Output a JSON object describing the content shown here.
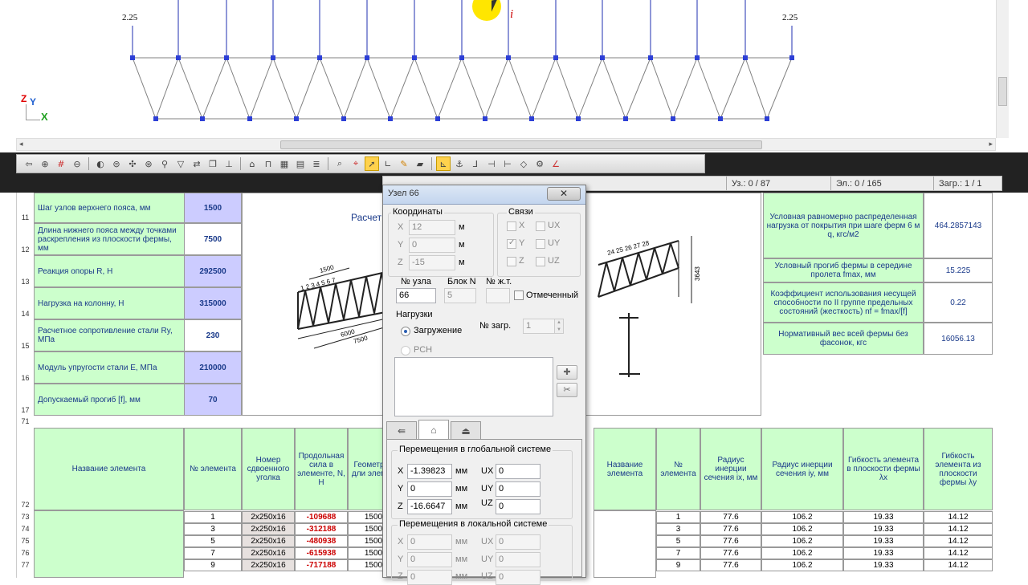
{
  "viewport": {
    "load_left": "2.25",
    "load_right": "2.25",
    "axis_z": "Z",
    "axis_y": "Y",
    "axis_x": "X",
    "cursor_label": "i"
  },
  "statusbar": {
    "nodes": "Уз.: 0 / 87",
    "elements": "Эл.: 0 / 165",
    "loads": "Загр.: 1 / 1"
  },
  "sheet": {
    "rows": [
      {
        "row": "11",
        "label": "Шаг узлов верхнего пояса, мм",
        "value": "1500"
      },
      {
        "row": "12",
        "label": "Длина нижнего пояса между точками раскрепления из плоскости фермы, мм",
        "value": "7500"
      },
      {
        "row": "13",
        "label": "Реакция опоры R, Н",
        "value": "292500"
      },
      {
        "row": "14",
        "label": "Нагрузка на колонну, Н",
        "value": "315000"
      },
      {
        "row": "15",
        "label": "Расчетное сопротивление стали Ry, МПа",
        "value": "230"
      },
      {
        "row": "16",
        "label": "Модуль упругости стали Е, МПа",
        "value": "210000"
      },
      {
        "row": "17",
        "label": "Допускаемый прогиб [f], мм",
        "value": "70"
      }
    ],
    "drawing_title": "Расчет",
    "right_rows": [
      {
        "label": "Условная равномерно распределенная нагрузка от покрытия при шаге ферм 6 м q, кгс/м2",
        "value": "464.2857143"
      },
      {
        "label": "Условный прогиб фермы в середине пролета fmax, мм",
        "value": "15.225"
      },
      {
        "label": "Коэффициент использования несущей способности по II группе предельных состояний (жесткость) nf = fmax/[f]",
        "value": "0.22"
      },
      {
        "label": "Нормативный вес всей фермы без фасонок, кгс",
        "value": "16056.13"
      }
    ],
    "row_71": "71",
    "row_72": "72",
    "table_headers": [
      "Название элемента",
      "№ элемента",
      "Номер сдвоенного уголка",
      "Продольная сила в элементе, N, Н",
      "Геометрая дли элемен"
    ],
    "table_headers_right": [
      "Название элемента",
      "№ элемента",
      "Радиус инерции сечения ix, мм",
      "Радиус инерции сечения iy, мм",
      "Гибкость элемента в плоскости фермы λx",
      "Гибкость элемента из плоскости фермы λy"
    ],
    "table_rows": [
      {
        "row": "73",
        "n": "1",
        "section": "2x250x16",
        "force": "-109688",
        "len": "1500",
        "ix": "77.6",
        "iy": "106.2",
        "lx": "19.33",
        "ly": "14.12"
      },
      {
        "row": "74",
        "n": "3",
        "section": "2x250x16",
        "force": "-312188",
        "len": "1500",
        "ix": "77.6",
        "iy": "106.2",
        "lx": "19.33",
        "ly": "14.12"
      },
      {
        "row": "75",
        "n": "5",
        "section": "2x250x16",
        "force": "-480938",
        "len": "1500",
        "ix": "77.6",
        "iy": "106.2",
        "lx": "19.33",
        "ly": "14.12"
      },
      {
        "row": "76",
        "n": "7",
        "section": "2x250x16",
        "force": "-615938",
        "len": "1500",
        "ix": "77.6",
        "iy": "106.2",
        "lx": "19.33",
        "ly": "14.12"
      },
      {
        "row": "77",
        "n": "9",
        "section": "2x250x16",
        "force": "-717188",
        "len": "1500",
        "ix": "77.6",
        "iy": "106.2",
        "lx": "19.33",
        "ly": "14.12"
      }
    ],
    "drawing_dims": {
      "d1500": "1500",
      "d6000": "6000",
      "d7500": "7500",
      "d3643": "3643",
      "nums_left": "1 2 3 4 5 6 7",
      "nums_right": "24 25 26 27 28"
    }
  },
  "dialog": {
    "title": "Узел 66",
    "close": "✕",
    "coords_legend": "Координаты",
    "x_label": "X",
    "x_value": "12",
    "y_label": "Y",
    "y_value": "0",
    "z_label": "Z",
    "z_value": "-15",
    "unit_m": "м",
    "links_legend": "Связи",
    "link_x": "X",
    "link_y": "Y",
    "link_z": "Z",
    "link_ux": "UX",
    "link_uy": "UY",
    "link_uz": "UZ",
    "node_no_label": "№ узла",
    "node_no": "66",
    "block_label": "Блок N",
    "block_no": "5",
    "jt_label": "№ ж.т.",
    "marked_label": "Отмеченный",
    "loads_legend": "Нагрузки",
    "loading_label": "Загружение",
    "load_no_label": "№ загр.",
    "load_no": "1",
    "rsn_label": "РСН",
    "global_legend": "Перемещения в глобальной системе",
    "gx": "-1.39823",
    "gy": "0",
    "gz": "-16.6647",
    "gux": "0",
    "guy": "0",
    "guz": "0",
    "unit_mm": "мм",
    "ux_label": "UX",
    "uy_label": "UY",
    "uz_label": "UZ",
    "local_legend": "Перемещения в локальной системе",
    "lx": "0",
    "ly": "0",
    "lz": "0",
    "lux": "0",
    "luy": "0",
    "luz": "0"
  },
  "colors": {
    "green_cell": "#ccffcc",
    "blue_cell": "#ccccff",
    "force_red": "#cc0000",
    "label_blue": "#1a3a8a",
    "highlight_yellow": "#ffd24d"
  }
}
